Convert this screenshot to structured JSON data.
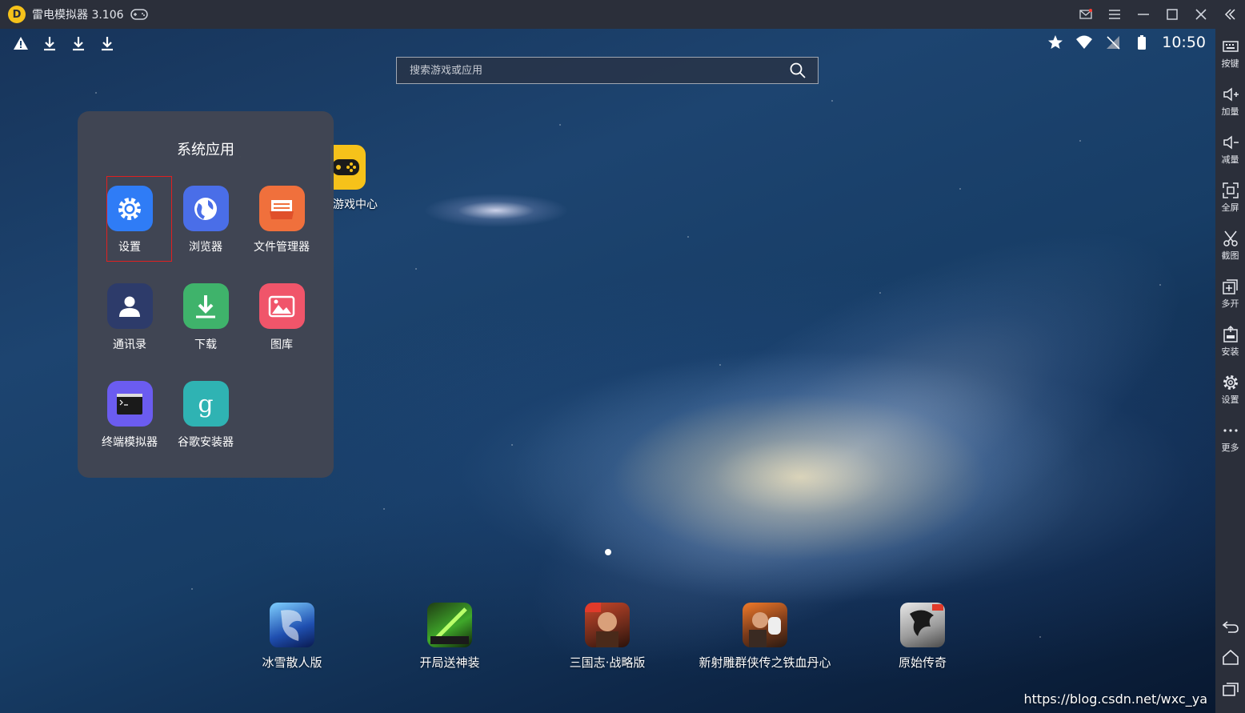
{
  "titlebar": {
    "logo_letter": "D",
    "title": "雷电模拟器 3.106"
  },
  "status": {
    "time": "10:50"
  },
  "search": {
    "placeholder": "搜索游戏或应用"
  },
  "desktop": {
    "game_center_label": "游戏中心"
  },
  "folder": {
    "title": "系统应用",
    "apps": [
      {
        "label": "设置",
        "color": "#2f7cf6"
      },
      {
        "label": "浏览器",
        "color": "#4a6ee8"
      },
      {
        "label": "文件管理器",
        "color": "#f0703c"
      },
      {
        "label": "通讯录",
        "color": "#2d3b6a"
      },
      {
        "label": "下载",
        "color": "#3fb36b"
      },
      {
        "label": "图库",
        "color": "#f0556a"
      },
      {
        "label": "终端模拟器",
        "color": "#6b5cf0"
      },
      {
        "label": "谷歌安装器",
        "color": "#2fb3b3"
      }
    ]
  },
  "dock": [
    {
      "label": "冰雪散人版"
    },
    {
      "label": "开局送神装"
    },
    {
      "label": "三国志·战略版"
    },
    {
      "label": "新射雕群侠传之铁血丹心"
    },
    {
      "label": "原始传奇"
    }
  ],
  "sidebar": {
    "items": [
      {
        "label": "按键"
      },
      {
        "label": "加量"
      },
      {
        "label": "减量"
      },
      {
        "label": "全屏"
      },
      {
        "label": "截图"
      },
      {
        "label": "多开"
      },
      {
        "label": "安装"
      },
      {
        "label": "设置"
      },
      {
        "label": "更多"
      }
    ]
  },
  "watermark": "https://blog.csdn.net/wxc_ya"
}
